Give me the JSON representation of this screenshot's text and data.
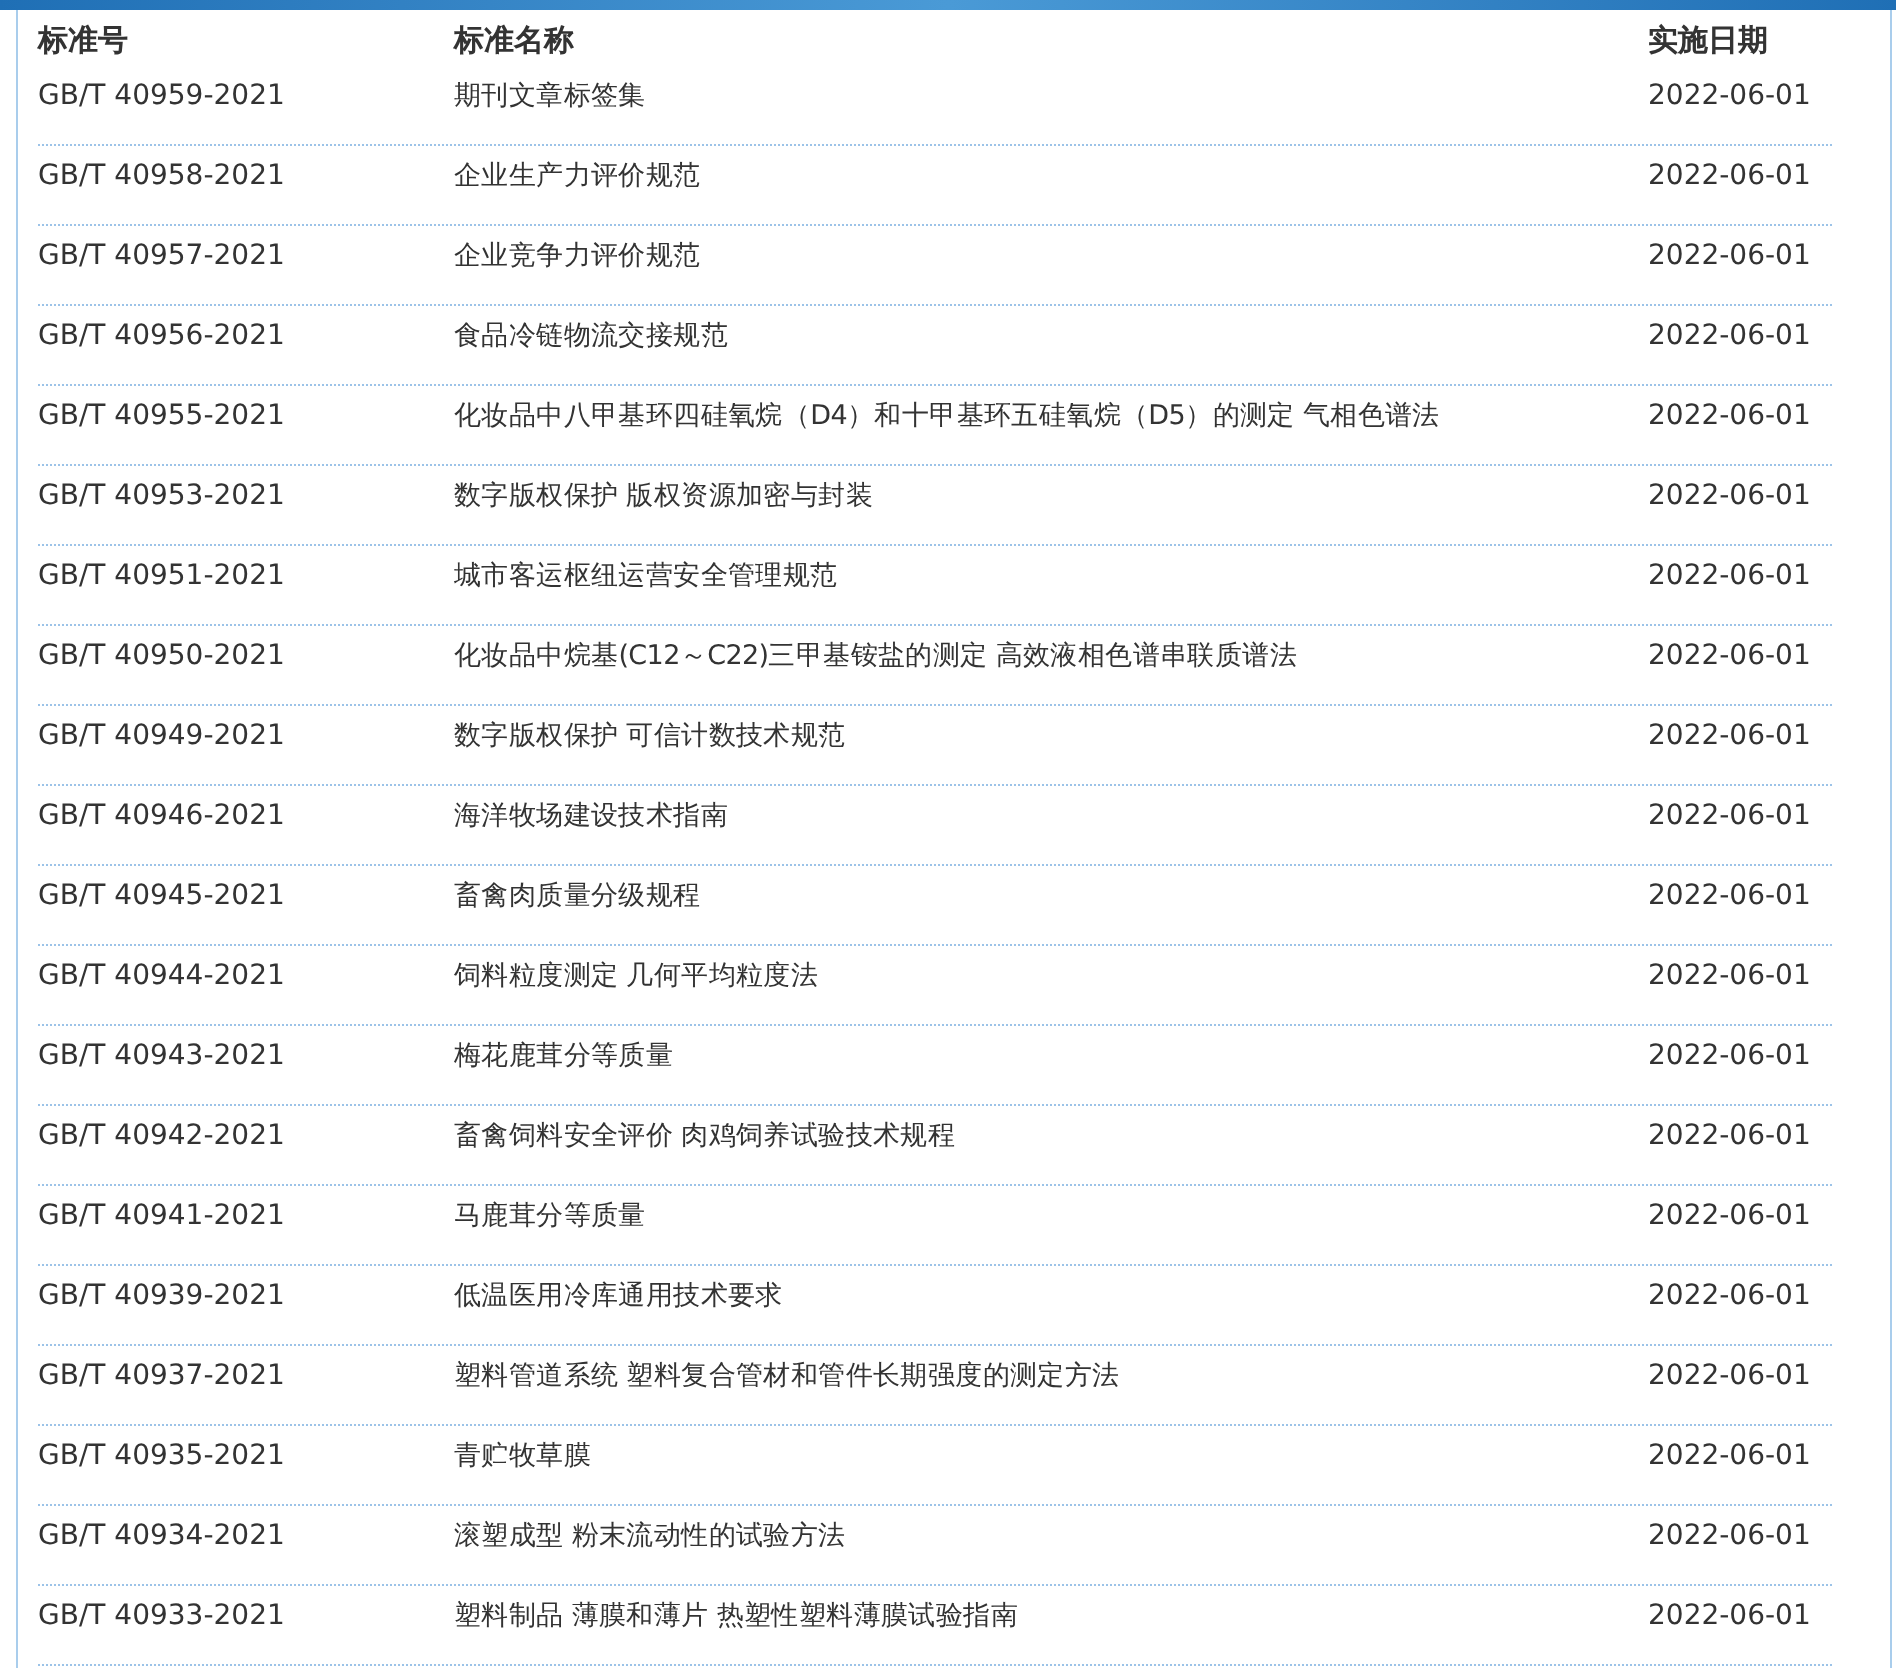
{
  "columns": [
    "标准号",
    "标准名称",
    "实施日期"
  ],
  "rows": [
    {
      "code": "GB/T 40959-2021",
      "name": "期刊文章标签集",
      "date": "2022-06-01"
    },
    {
      "code": "GB/T 40958-2021",
      "name": "企业生产力评价规范",
      "date": "2022-06-01"
    },
    {
      "code": "GB/T 40957-2021",
      "name": "企业竞争力评价规范",
      "date": "2022-06-01"
    },
    {
      "code": "GB/T 40956-2021",
      "name": "食品冷链物流交接规范",
      "date": "2022-06-01"
    },
    {
      "code": "GB/T 40955-2021",
      "name": "化妆品中八甲基环四硅氧烷（D4）和十甲基环五硅氧烷（D5）的测定 气相色谱法",
      "date": "2022-06-01"
    },
    {
      "code": "GB/T 40953-2021",
      "name": "数字版权保护 版权资源加密与封装",
      "date": "2022-06-01"
    },
    {
      "code": "GB/T 40951-2021",
      "name": "城市客运枢纽运营安全管理规范",
      "date": "2022-06-01"
    },
    {
      "code": "GB/T 40950-2021",
      "name": "化妆品中烷基(C12～C22)三甲基铵盐的测定 高效液相色谱串联质谱法",
      "date": "2022-06-01"
    },
    {
      "code": "GB/T 40949-2021",
      "name": "数字版权保护 可信计数技术规范",
      "date": "2022-06-01"
    },
    {
      "code": "GB/T 40946-2021",
      "name": "海洋牧场建设技术指南",
      "date": "2022-06-01"
    },
    {
      "code": "GB/T 40945-2021",
      "name": "畜禽肉质量分级规程",
      "date": "2022-06-01"
    },
    {
      "code": "GB/T 40944-2021",
      "name": "饲料粒度测定 几何平均粒度法",
      "date": "2022-06-01"
    },
    {
      "code": "GB/T 40943-2021",
      "name": "梅花鹿茸分等质量",
      "date": "2022-06-01"
    },
    {
      "code": "GB/T 40942-2021",
      "name": "畜禽饲料安全评价 肉鸡饲养试验技术规程",
      "date": "2022-06-01"
    },
    {
      "code": "GB/T 40941-2021",
      "name": "马鹿茸分等质量",
      "date": "2022-06-01"
    },
    {
      "code": "GB/T 40939-2021",
      "name": "低温医用冷库通用技术要求",
      "date": "2022-06-01"
    },
    {
      "code": "GB/T 40937-2021",
      "name": "塑料管道系统 塑料复合管材和管件长期强度的测定方法",
      "date": "2022-06-01"
    },
    {
      "code": "GB/T 40935-2021",
      "name": "青贮牧草膜",
      "date": "2022-06-01"
    },
    {
      "code": "GB/T 40934-2021",
      "name": "滚塑成型 粉末流动性的试验方法",
      "date": "2022-06-01"
    },
    {
      "code": "GB/T 40933-2021",
      "name": "塑料制品 薄膜和薄片 热塑性塑料薄膜试验指南",
      "date": "2022-06-01"
    }
  ]
}
